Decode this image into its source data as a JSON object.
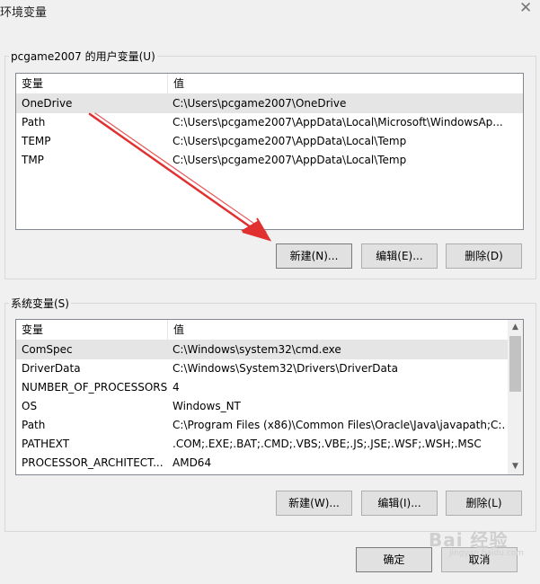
{
  "window": {
    "title": "环境变量",
    "close_glyph": "✕"
  },
  "user_vars": {
    "group_label": "pcgame2007 的用户变量(U)",
    "columns": [
      "变量",
      "值"
    ],
    "rows": [
      {
        "name": "OneDrive",
        "value": "C:\\Users\\pcgame2007\\OneDrive",
        "selected": true
      },
      {
        "name": "Path",
        "value": "C:\\Users\\pcgame2007\\AppData\\Local\\Microsoft\\WindowsAp..."
      },
      {
        "name": "TEMP",
        "value": "C:\\Users\\pcgame2007\\AppData\\Local\\Temp"
      },
      {
        "name": "TMP",
        "value": "C:\\Users\\pcgame2007\\AppData\\Local\\Temp"
      }
    ],
    "buttons": {
      "new": "新建(N)...",
      "edit": "编辑(E)...",
      "delete": "删除(D)"
    }
  },
  "system_vars": {
    "group_label": "系统变量(S)",
    "columns": [
      "变量",
      "值"
    ],
    "rows": [
      {
        "name": "ComSpec",
        "value": "C:\\Windows\\system32\\cmd.exe",
        "selected": true
      },
      {
        "name": "DriverData",
        "value": "C:\\Windows\\System32\\Drivers\\DriverData"
      },
      {
        "name": "NUMBER_OF_PROCESSORS",
        "value": "4"
      },
      {
        "name": "OS",
        "value": "Windows_NT"
      },
      {
        "name": "Path",
        "value": "C:\\Program Files (x86)\\Common Files\\Oracle\\Java\\javapath;C:..."
      },
      {
        "name": "PATHEXT",
        "value": ".COM;.EXE;.BAT;.CMD;.VBS;.VBE;.JS;.JSE;.WSF;.WSH;.MSC"
      },
      {
        "name": "PROCESSOR_ARCHITECT...",
        "value": "AMD64"
      }
    ],
    "buttons": {
      "new": "新建(W)...",
      "edit": "编辑(I)...",
      "delete": "删除(L)"
    }
  },
  "footer": {
    "ok": "确定",
    "cancel": "取消"
  },
  "watermark": {
    "text": "Bai 经验",
    "sub": "jingyan.baidu.com"
  },
  "colors": {
    "arrow": "#e03030",
    "selection": "#e5e5e5"
  }
}
